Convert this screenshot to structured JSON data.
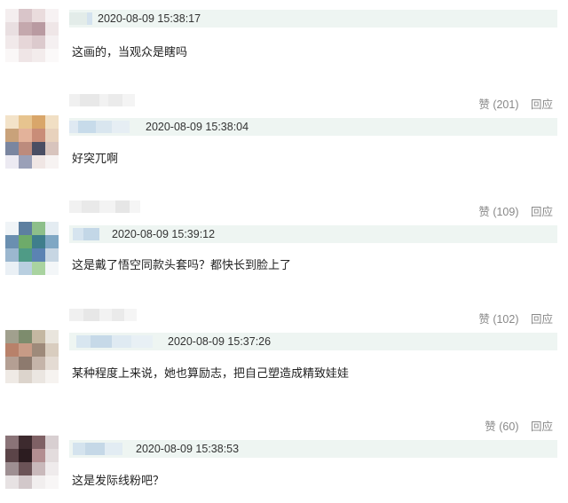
{
  "comments": [
    {
      "time": "2020-08-09 15:38:17",
      "text": "这画的，当观众是瞎吗",
      "like": "赞 (201)",
      "reply": "回应",
      "avatar_colors": [
        "#f4eeef",
        "#d9c5c9",
        "#eadcdd",
        "#f7f2f3",
        "#e9dfe1",
        "#c4a8ad",
        "#b99aa1",
        "#efe6e7",
        "#f1e9ea",
        "#e6d6d8",
        "#dccacd",
        "#f5f0f1",
        "#faf7f7",
        "#efe5e6",
        "#f3ecec",
        "#fbf9f9"
      ]
    },
    {
      "time": "2020-08-09 15:38:04",
      "text": "好突兀啊",
      "like": "赞 (109)",
      "reply": "回应",
      "avatar_colors": [
        "#f3e3c9",
        "#e7c48f",
        "#d9a66a",
        "#f1dfc4",
        "#c9a27a",
        "#e3b29a",
        "#c98d78",
        "#e8d2bd",
        "#7a86a0",
        "#bc8b7d",
        "#4a4e63",
        "#d8c4bd",
        "#eceaf2",
        "#9aa0b8",
        "#f0e6e4",
        "#f7f3f2"
      ]
    },
    {
      "time": "2020-08-09 15:39:12",
      "text": "这是戴了悟空同款头套吗？都快长到脸上了",
      "like": "赞 (102)",
      "reply": "回应",
      "avatar_colors": [
        "#f0f4f7",
        "#5d7fa0",
        "#8dbf8a",
        "#e4ecf2",
        "#6a8fb0",
        "#6eab6a",
        "#3f7e8c",
        "#7fa7c4",
        "#9bb7cf",
        "#4f9b86",
        "#5b83b3",
        "#c7d6e3",
        "#eaf0f5",
        "#b9cfe0",
        "#a9d3a0",
        "#f3f6f8"
      ]
    },
    {
      "time": "2020-08-09 15:37:26",
      "text": "某种程度上来说，她也算励志，把自己塑造成精致娃娃",
      "like": "赞 (60)",
      "reply": "回应",
      "avatar_colors": [
        "#a1a08e",
        "#7d8c6d",
        "#c4b7a1",
        "#e9e5dd",
        "#b8816a",
        "#c79b86",
        "#9e8a7a",
        "#d9cdbf",
        "#b49f93",
        "#8d7a6e",
        "#c5b4a9",
        "#e4dbd3",
        "#efeae5",
        "#dcd4cc",
        "#ebe6e1",
        "#f6f3f0"
      ]
    },
    {
      "time": "2020-08-09 15:38:53",
      "text": "这是发际线粉吧？",
      "like": "",
      "reply": "",
      "avatar_colors": [
        "#8a7377",
        "#3d2a2e",
        "#7f6165",
        "#d8cfd1",
        "#5b4448",
        "#2c1c20",
        "#b38e91",
        "#e3dcdd",
        "#9e8f92",
        "#6b5357",
        "#c9b9bb",
        "#efebec",
        "#e7e2e3",
        "#d2c8ca",
        "#f1eeee",
        "#f8f6f6"
      ]
    }
  ]
}
